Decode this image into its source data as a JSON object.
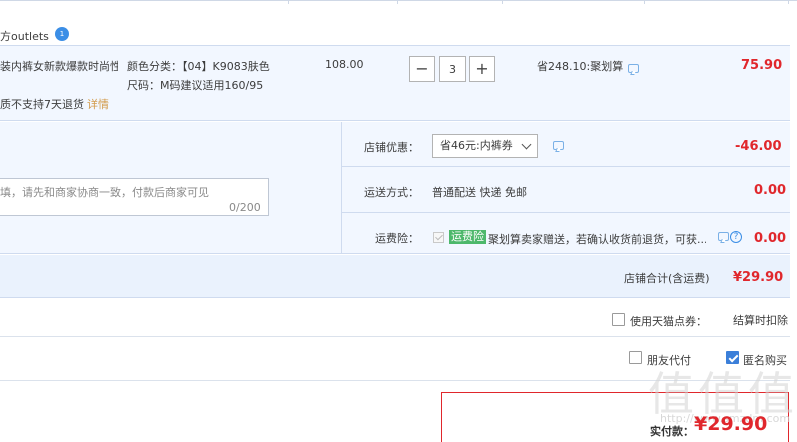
{
  "shop": {
    "name": "方outlets",
    "badge": "1"
  },
  "item": {
    "title": "装内裤女新款爆款时尚性...",
    "note": "质不支持7天退货",
    "note_link": "详情",
    "sku_color": "颜色分类：【04】K9083肤色",
    "sku_size": "尺码：M码建议适用160/95",
    "unit_price": "108.00",
    "quantity": "3",
    "minus_symbol": "−",
    "plus_symbol": "+",
    "saving": "省248.10:聚划算",
    "total": "75.90"
  },
  "memo": {
    "placeholder": "填，请先和商家协商一致，付款后商家可见",
    "count": "0/200"
  },
  "shop_discount": {
    "label": "店铺优惠：",
    "selected": "省46元:内裤券",
    "amount": "-46.00"
  },
  "shipping": {
    "label": "运送方式：",
    "value": "普通配送 快递 免邮",
    "amount": "0.00"
  },
  "insurance": {
    "label": "运费险：",
    "badge": "运费险",
    "text": "聚划算卖家赠送，若确认收货前退货，可获...",
    "amount": "0.00"
  },
  "subtotal": {
    "label": "店铺合计(含运费)",
    "value": "¥29.90"
  },
  "points": {
    "label": "使用天猫点券：",
    "deduct": "结算时扣除"
  },
  "friend_pay": {
    "label": "朋友代付"
  },
  "anonymous": {
    "label": "匿名购买"
  },
  "payment": {
    "label": "实付款：",
    "value": "¥29.90"
  },
  "icons": {
    "chat": "chat-icon",
    "help": "help-icon",
    "chevron": "chevron-down-icon"
  },
  "colors": {
    "accent_red": "#e0272c",
    "row_bg": "#f2f7ff",
    "subtotal_bg": "#eaf2fd",
    "link_gold": "#d29a49",
    "badge_green": "#4db86b",
    "check_blue": "#3b7fd9"
  },
  "watermark": {
    "text": "值值值",
    "url": "http://www.smzdm.com"
  }
}
